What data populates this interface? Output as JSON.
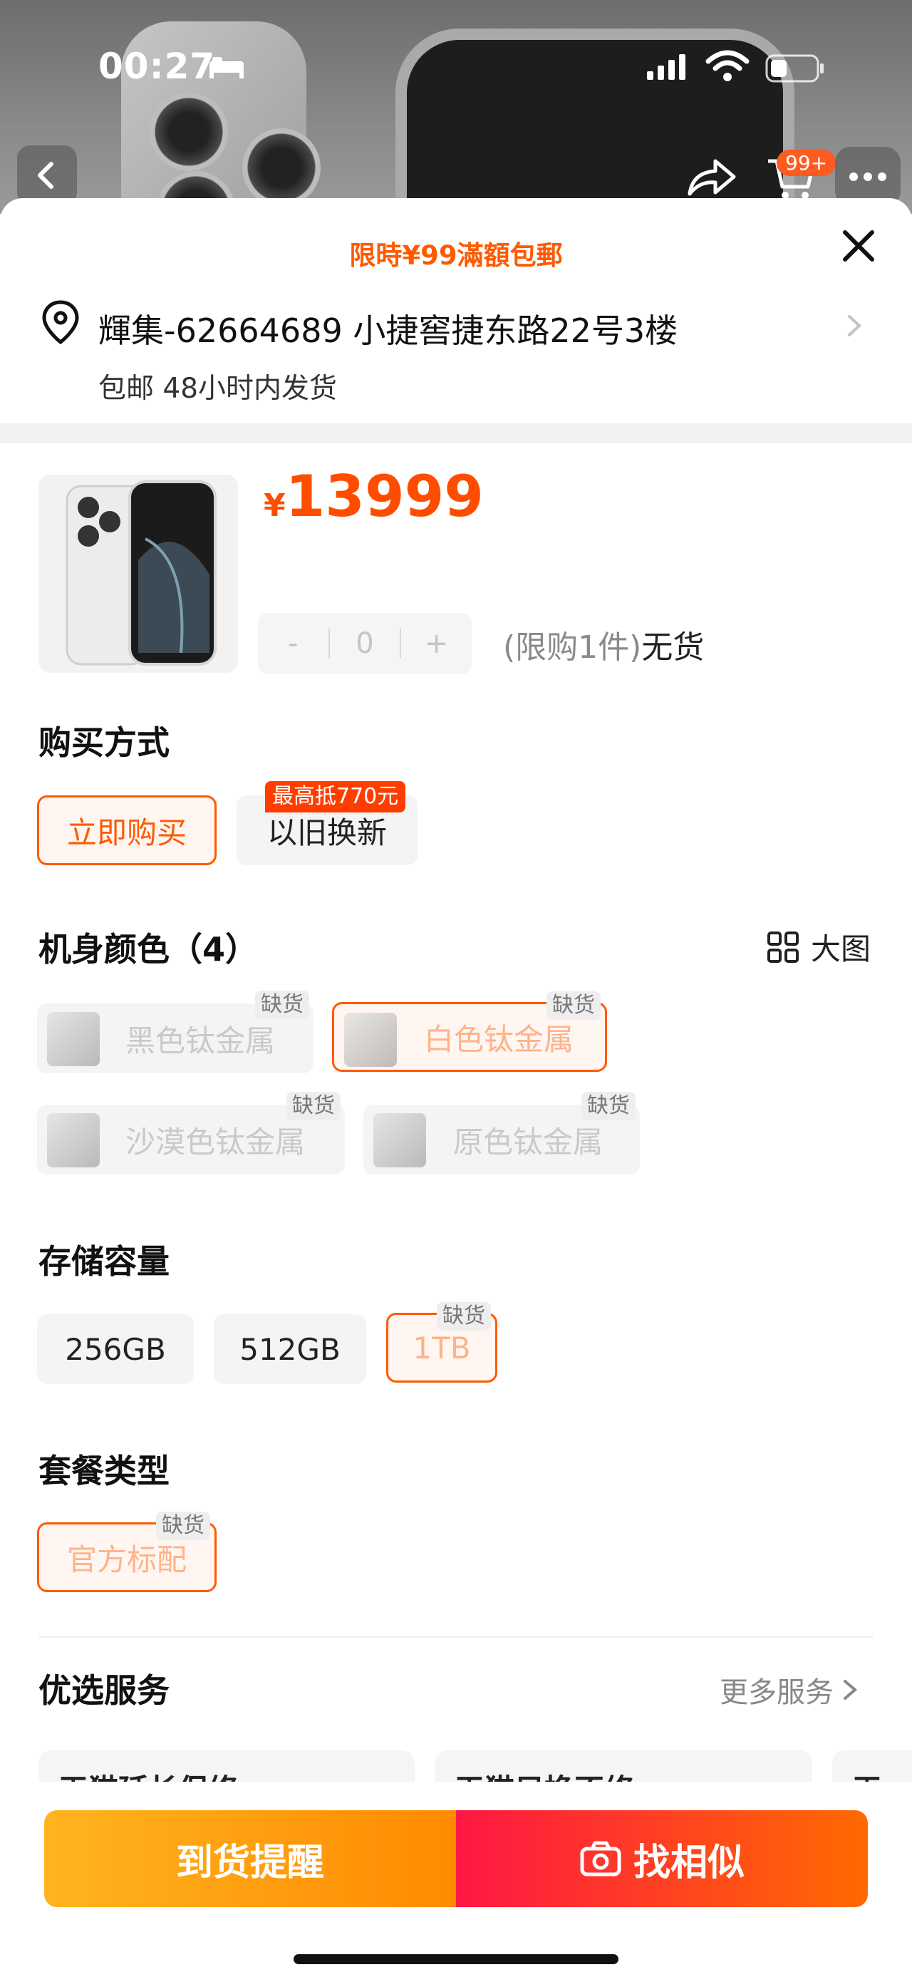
{
  "status_bar": {
    "time": "00:27"
  },
  "header": {
    "cart_badge": "99+"
  },
  "sheet": {
    "promo": "限時¥99滿額包郵",
    "address": "輝集-62664689 小捷窖捷东路22号3楼",
    "shipping": "包邮 48小时内发货"
  },
  "product": {
    "currency": "¥",
    "price": "13999",
    "qty_minus": "-",
    "qty_value": "0",
    "qty_plus": "+",
    "limit": "(限购1件)",
    "stock": "无货"
  },
  "purchase_method": {
    "title": "购买方式",
    "options": [
      {
        "label": "立即购买",
        "selected": true
      },
      {
        "label": "以旧换新",
        "tag": "最高抵770元"
      }
    ]
  },
  "color": {
    "title": "机身颜色（4）",
    "bigview_label": "大图",
    "out_label": "缺货",
    "options": [
      {
        "label": "黑色钛金属"
      },
      {
        "label": "白色钛金属",
        "selected": true
      },
      {
        "label": "沙漠色钛金属"
      },
      {
        "label": "原色钛金属"
      }
    ]
  },
  "storage": {
    "title": "存储容量",
    "options": [
      {
        "label": "256GB"
      },
      {
        "label": "512GB"
      },
      {
        "label": "1TB",
        "selected": true
      }
    ]
  },
  "package": {
    "title": "套餐类型",
    "options": [
      {
        "label": "官方标配",
        "selected": true
      }
    ]
  },
  "services": {
    "title": "优选服务",
    "more": "更多服务",
    "cards": [
      "天猫延长保修",
      "天猫只换不修",
      "天"
    ]
  },
  "actions": {
    "notify": "到货提醒",
    "similar": "找相似"
  },
  "colors": {
    "accent": "#ff5a00",
    "price": "#ff4d00",
    "notify_start": "#ffb41f",
    "similar_start": "#ff1744"
  }
}
